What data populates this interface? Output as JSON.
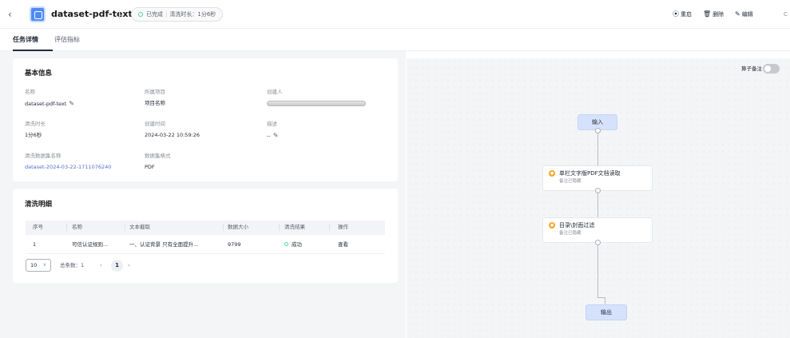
{
  "header": {
    "back_icon": "chevron-left-icon",
    "logo_icon": "dataset-icon",
    "title": "dataset-pdf-text",
    "status_label": "已完成",
    "duration_label": "清洗时长：1分6秒",
    "actions": [
      {
        "icon": "restart-icon",
        "glyph": "⦿",
        "label": "重启"
      },
      {
        "icon": "delete-icon",
        "glyph": "🗑",
        "label": "删除"
      },
      {
        "icon": "edit-icon",
        "glyph": "✎",
        "label": "编辑"
      }
    ]
  },
  "tabs": [
    {
      "label": "任务详情",
      "active": true
    },
    {
      "label": "评估指标",
      "active": false
    }
  ],
  "basic_info": {
    "heading": "基本信息",
    "fields": {
      "name_label": "名称",
      "name_value": "dataset-pdf-text",
      "project_label": "所属项目",
      "project_value": "项目名称",
      "creator_label": "创建人",
      "duration_label": "清洗时长",
      "duration_value": "1分6秒",
      "created_label": "创建时间",
      "created_value": "2024-03-22 10:59:26",
      "desc_label": "描述",
      "desc_value": "--",
      "dataset_label": "清洗数据集名称",
      "dataset_value": "dataset-2024-03-22-1711076240",
      "format_label": "数据集格式",
      "format_value": "PDF"
    }
  },
  "details": {
    "heading": "清洗明细",
    "columns": [
      "序号",
      "名称",
      "文本截取",
      "数据大小",
      "清洗结果",
      "操作"
    ],
    "rows": [
      {
        "index": "1",
        "name": "可信认证规则...",
        "excerpt": "一、认证背景 只有全面提升...",
        "size": "9799",
        "result": "成功",
        "action": "查看"
      }
    ],
    "page_size": "10",
    "total": "总条数：1",
    "current_page": "1"
  },
  "canvas": {
    "toggle_label": "算子备注",
    "input_label": "输入",
    "output_label": "输出",
    "nodes": [
      {
        "title": "单栏文字版PDF文档读取",
        "subtitle": "备注已隐藏"
      },
      {
        "title": "目录\\封面过滤",
        "subtitle": "备注已隐藏"
      }
    ]
  }
}
